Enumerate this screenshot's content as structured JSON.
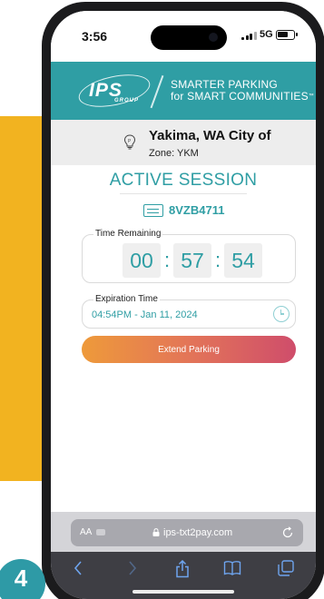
{
  "status_bar": {
    "time": "3:56",
    "network": "5G",
    "battery_level": 0.7
  },
  "brand": {
    "logo_text": "IPS",
    "logo_subtext": "GROUP",
    "tagline_line1": "SMARTER PARKING",
    "tagline_line2_prefix": "for SMART ",
    "tagline_line2_emphasis": "COMMUNITIES",
    "tagline_mark": "™"
  },
  "location": {
    "city": "Yakima, WA City of",
    "zone": "Zone: YKM"
  },
  "session": {
    "title": "ACTIVE SESSION",
    "plate_number": "8VZB4711",
    "time_remaining_label": "Time Remaining",
    "time_remaining": {
      "hours": "00",
      "minutes": "57",
      "seconds": "54"
    },
    "separator": ":",
    "expiration_label": "Expiration Time",
    "expiration_value": "04:54PM - Jan 11, 2024",
    "extend_button_label": "Extend Parking"
  },
  "browser": {
    "text_size_label": "AA",
    "url": "ips-txt2pay.com",
    "toolbar_icons": [
      "back-icon",
      "forward-icon",
      "share-icon",
      "bookmarks-icon",
      "tabs-icon"
    ]
  },
  "badge": {
    "step_number": "4"
  },
  "colors": {
    "brand_teal": "#2f9ea4",
    "accent_gold": "#f2b320",
    "button_gradient_start": "#ee9a3a",
    "button_gradient_end": "#cf4d6b",
    "browser_link_blue": "#6ea4ee"
  }
}
